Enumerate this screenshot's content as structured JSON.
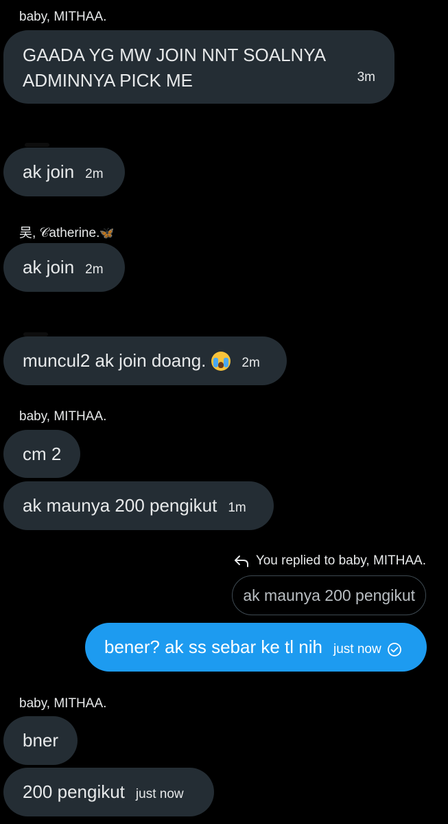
{
  "messages": [
    {
      "sender": "baby, MITHAA.",
      "text": "GAADA YG MW JOIN NNT SOALNYA ADMINNYA PICK ME",
      "time": "3m"
    },
    {
      "sender": "",
      "text": "ak join",
      "time": "2m"
    },
    {
      "sender": "吴, 𝒞atherine.",
      "sender_emoji": "🦋",
      "text": "ak join",
      "time": "2m"
    },
    {
      "sender": "",
      "text": "muncul2 ak join doang.",
      "text_emoji": "crying-face",
      "time": "2m"
    },
    {
      "sender": "baby, MITHAA.",
      "text": "cm 2",
      "time": ""
    },
    {
      "sender": "",
      "text": "ak maunya 200 pengikut",
      "time": "1m"
    },
    {
      "sender": "baby, MITHAA.",
      "text": "bner",
      "time": ""
    },
    {
      "sender": "",
      "text": "200 pengikut",
      "time": "just now"
    }
  ],
  "reply": {
    "note": "You replied to baby, MITHAA.",
    "quoted": "ak maunya 200 pengikut",
    "text": "bener? ak ss sebar ke tl nih",
    "time": "just now",
    "status_icon": "check-circle-icon"
  },
  "colors": {
    "background": "#000000",
    "incoming_bubble": "#242d34",
    "outgoing_bubble": "#1d9bf0",
    "text": "#e7e9ea"
  }
}
